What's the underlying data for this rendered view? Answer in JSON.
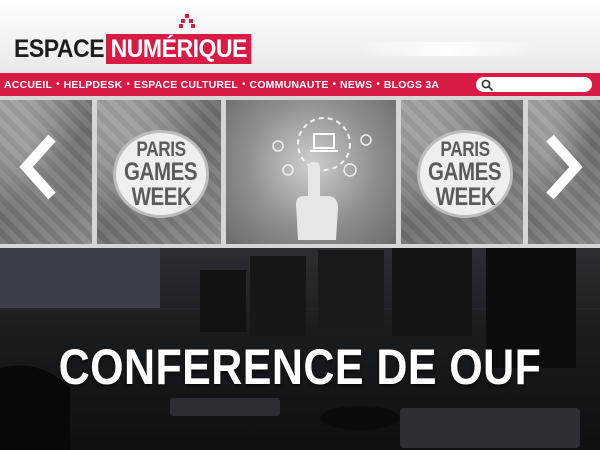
{
  "logo": {
    "left": "ESPACE",
    "right": "NUMÉRIQUE"
  },
  "nav": {
    "items": [
      "ACCUEIL",
      "HELPDESK",
      "ESPACE CULTUREL",
      "COMMUNAUTE",
      "NEWS",
      "BLOGS 3A"
    ],
    "separator": "•"
  },
  "search": {
    "placeholder": ""
  },
  "slider": {
    "slides": [
      {
        "name": "slide-field-left",
        "kind": "image"
      },
      {
        "name": "slide-paris-games-week-1",
        "kind": "logo",
        "lines": [
          "PARIS",
          "GAMES",
          "WEEK"
        ]
      },
      {
        "name": "slide-touch-tech",
        "kind": "image"
      },
      {
        "name": "slide-paris-games-week-2",
        "kind": "logo",
        "lines": [
          "PARIS",
          "GAMES",
          "WEEK"
        ]
      },
      {
        "name": "slide-field-right",
        "kind": "image"
      }
    ],
    "prev_icon": "chevron-left-icon",
    "next_icon": "chevron-right-icon"
  },
  "hero": {
    "title": "CONFERENCE DE OUF"
  },
  "colors": {
    "brand": "#d81a44",
    "header_bg": "#f2f2f2",
    "slider_bg": "#d6d6d6"
  }
}
